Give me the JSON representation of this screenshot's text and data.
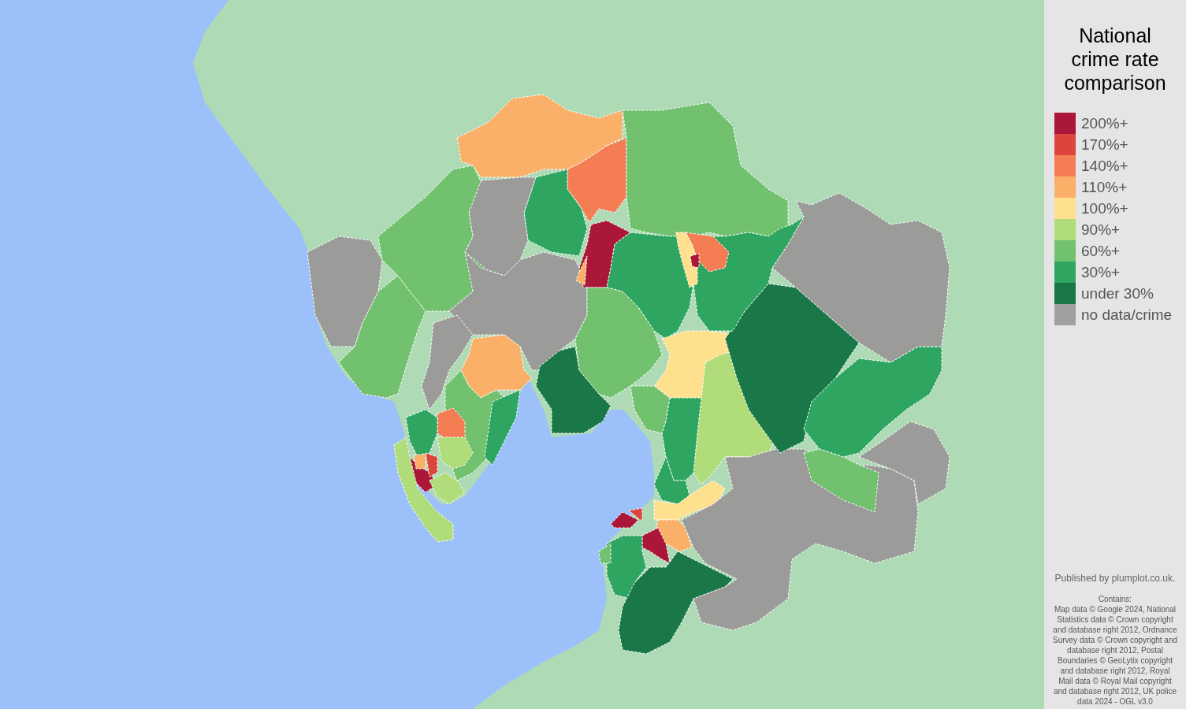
{
  "map": {
    "regions": [
      {
        "color": "#fbb06a"
      },
      {
        "color": "#f47d53"
      },
      {
        "color": "#72c16f"
      },
      {
        "color": "#2fa562"
      },
      {
        "color": "#9b9c99"
      },
      {
        "color": "#72c16f"
      },
      {
        "color": "#9b9c99"
      },
      {
        "color": "#72c16f"
      },
      {
        "color": "#9b9c99"
      },
      {
        "color": "#9b9c99"
      },
      {
        "color": "#ab1738"
      },
      {
        "color": "#fbb06a"
      },
      {
        "color": "#2fa562"
      },
      {
        "color": "#72c16f"
      },
      {
        "color": "#1a7748"
      },
      {
        "color": "#fbb06a"
      },
      {
        "color": "#72c16f"
      },
      {
        "color": "#2fa562"
      },
      {
        "color": "#f47d53"
      },
      {
        "color": "#2fa562"
      },
      {
        "color": "#b0dc79"
      },
      {
        "color": "#ab1738"
      },
      {
        "color": "#dd453c"
      },
      {
        "color": "#fbb06a"
      },
      {
        "color": "#b0dc79"
      },
      {
        "color": "#b0dc79"
      },
      {
        "color": "#fee08e"
      },
      {
        "color": "#b0dc79"
      },
      {
        "color": "#72c16f"
      },
      {
        "color": "#2fa562"
      },
      {
        "color": "#2fa562"
      },
      {
        "color": "#fee08e"
      },
      {
        "color": "#fbb06a"
      },
      {
        "color": "#ab1738"
      },
      {
        "color": "#dd453c"
      },
      {
        "color": "#ab1738"
      },
      {
        "color": "#2fa562"
      },
      {
        "color": "#72c16f"
      },
      {
        "color": "#1a7748"
      },
      {
        "color": "#9b9c99"
      },
      {
        "color": "#9b9c99"
      },
      {
        "color": "#1a7748"
      },
      {
        "color": "#2fa562"
      },
      {
        "color": "#72c16f"
      },
      {
        "color": "#9b9c99"
      },
      {
        "color": "#2fa562"
      },
      {
        "color": "#f47d53"
      },
      {
        "color": "#fee08e"
      },
      {
        "color": "#ab1738"
      }
    ]
  },
  "legend": {
    "title": "National crime rate comparison",
    "items": [
      {
        "label": "200%+",
        "color": "#ab1738"
      },
      {
        "label": "170%+",
        "color": "#dd453c"
      },
      {
        "label": "140%+",
        "color": "#f47d53"
      },
      {
        "label": "110%+",
        "color": "#fbb06a"
      },
      {
        "label": "100%+",
        "color": "#fee08e"
      },
      {
        "label": "90%+",
        "color": "#b0dc79"
      },
      {
        "label": "60%+",
        "color": "#72c16f"
      },
      {
        "label": "30%+",
        "color": "#2fa562"
      },
      {
        "label": "under 30%",
        "color": "#1a7748"
      },
      {
        "label": "no data/crime",
        "color": "#a0a0a0"
      }
    ]
  },
  "credits": {
    "publisher": "Published by plumplot.co.uk.",
    "contains_label": "Contains:",
    "attribution": "Map data © Google 2024, National Statistics data © Crown copyright and database right 2012, Ordnance Survey data © Crown copyright and database right 2012, Postal Boundaries © GeoLytix copyright and database right 2012, Royal Mail data © Royal Mail copyright and database right 2012, UK police data 2024 - OGL v3.0"
  }
}
